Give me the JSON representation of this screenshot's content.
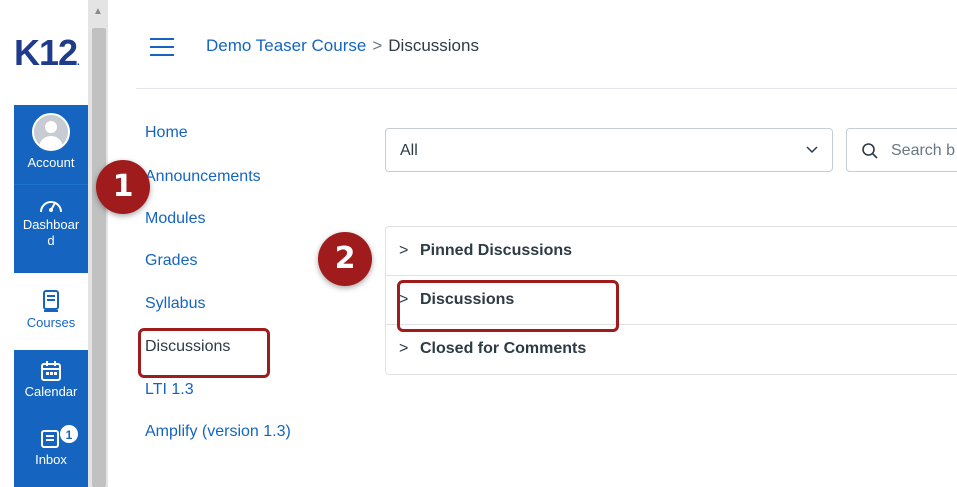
{
  "brand": {
    "logo_text": "K12"
  },
  "colors": {
    "nav_blue": "#1565c0",
    "annotation_red": "#a01c1c",
    "text_dark": "#2d3b45"
  },
  "global_nav": {
    "account": {
      "label": "Account",
      "icon": "avatar-icon"
    },
    "dashboard": {
      "label_line1": "Dashboar",
      "label_line2": "d",
      "icon": "speedometer-icon"
    },
    "courses": {
      "label": "Courses",
      "icon": "book-icon"
    },
    "calendar": {
      "label": "Calendar",
      "icon": "calendar-icon"
    },
    "inbox": {
      "label": "Inbox",
      "icon": "inbox-icon",
      "badge": "1"
    }
  },
  "breadcrumb": {
    "course": "Demo Teaser Course",
    "separator": ">",
    "current": "Discussions"
  },
  "course_nav": {
    "home": "Home",
    "announcements": "Announcements",
    "modules": "Modules",
    "grades": "Grades",
    "syllabus": "Syllabus",
    "discussions": "Discussions",
    "lti": "LTI 1.3",
    "amplify": "Amplify (version 1.3)"
  },
  "filter": {
    "selected": "All"
  },
  "search": {
    "placeholder": "Search b"
  },
  "groups": {
    "pinned": "Pinned Discussions",
    "discussions": "Discussions",
    "closed": "Closed for Comments",
    "caret": ">"
  },
  "annotations": {
    "step1": "1",
    "step2": "2"
  }
}
